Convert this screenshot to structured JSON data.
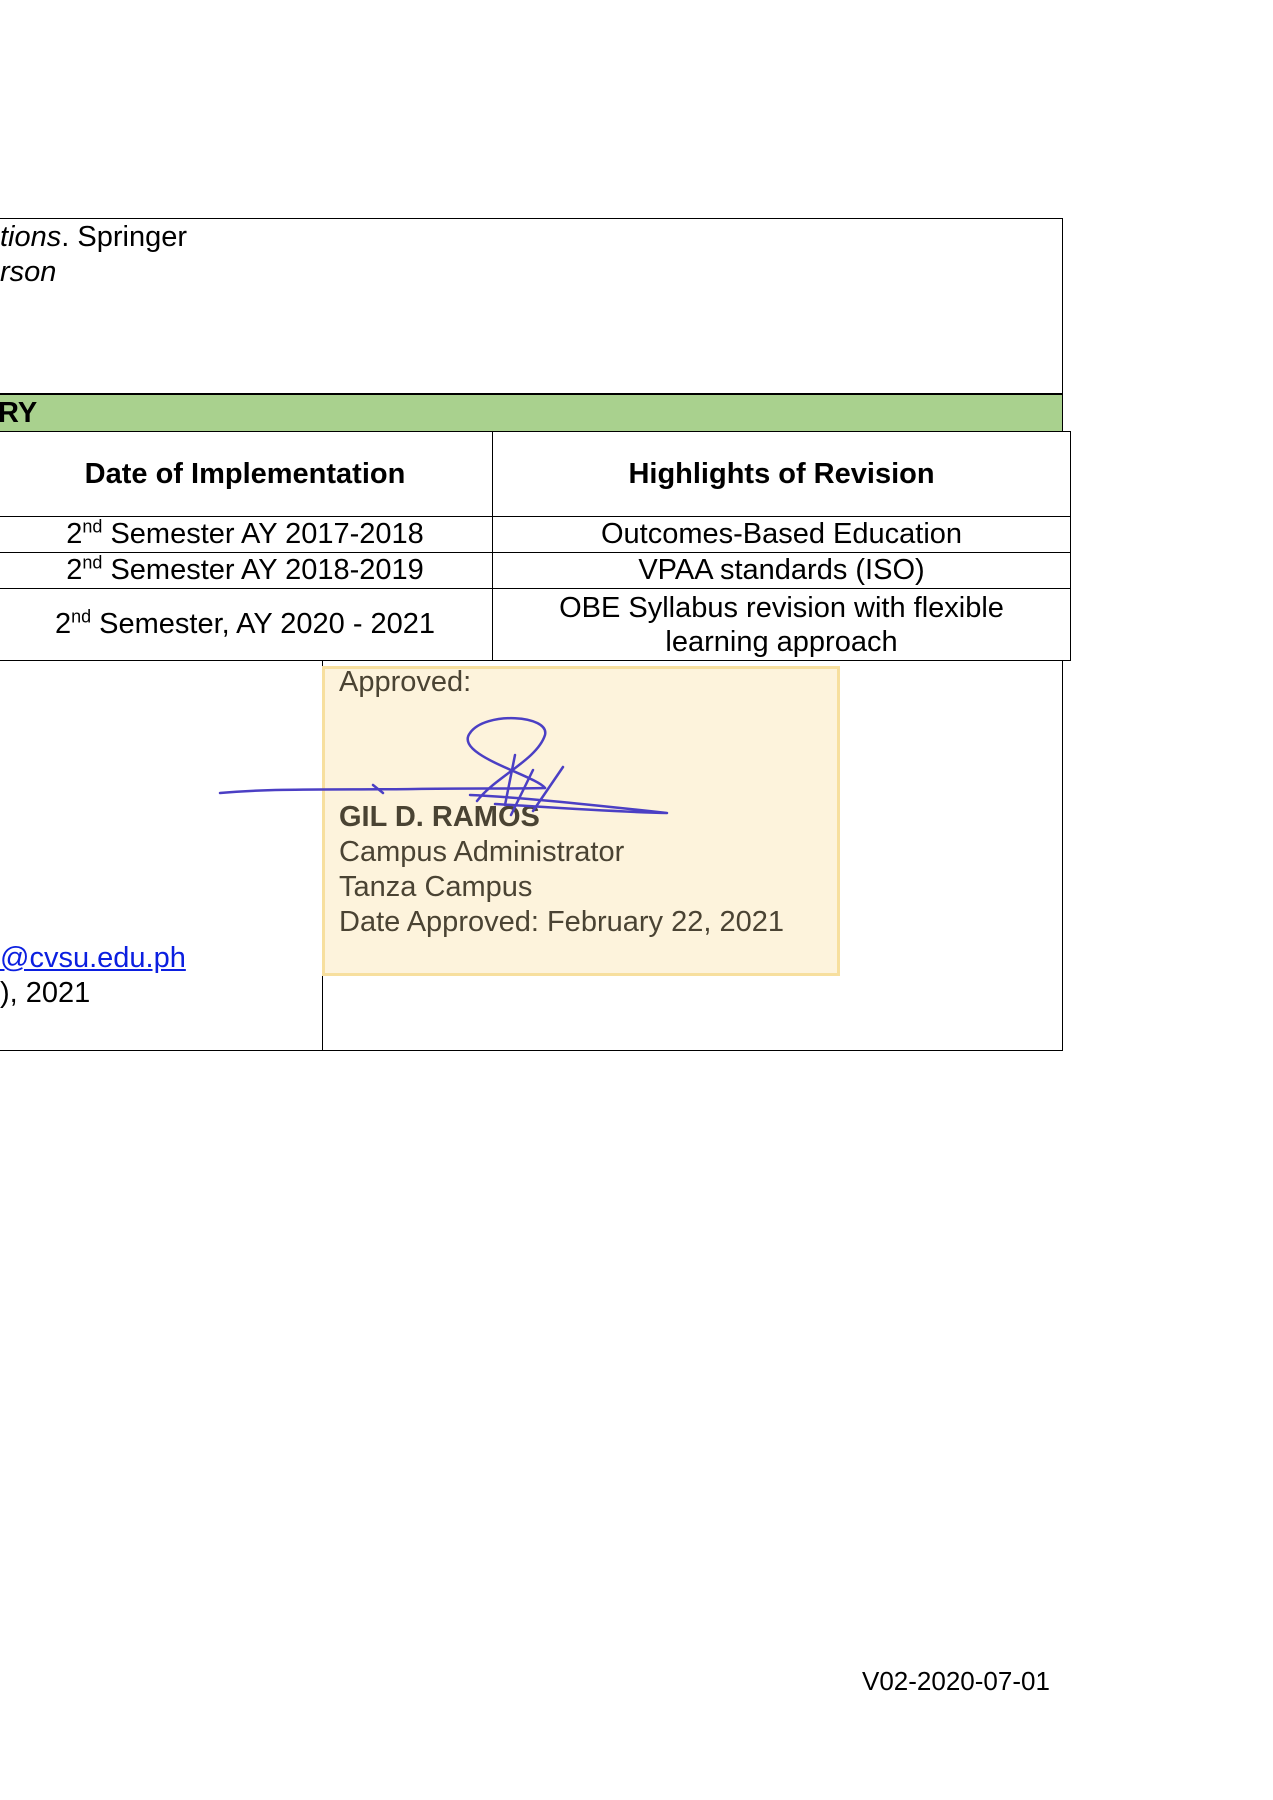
{
  "references": {
    "line1_italic": "tions",
    "line1_rest": ". Springer",
    "line2_italic": "rson"
  },
  "history_header": "RY",
  "revision_table": {
    "headers": [
      "Date of Implementation",
      "Highlights of Revision"
    ],
    "rows": [
      {
        "date_ordinal": "2",
        "date_sup": "nd",
        "date_rest": " Semester AY 2017-2018",
        "highlight": "Outcomes-Based Education"
      },
      {
        "date_ordinal": "2",
        "date_sup": "nd",
        "date_rest": " Semester AY 2018-2019",
        "highlight": "VPAA standards (ISO)"
      },
      {
        "date_ordinal": "2",
        "date_sup": "nd",
        "date_rest": " Semester, AY 2020 - 2021",
        "highlight_line1": "OBE Syllabus revision with flexible",
        "highlight_line2": "learning approach"
      }
    ]
  },
  "prepared_fragment": {
    "email": "@cvsu.edu.ph",
    "date": "), 2021"
  },
  "approval_stamp": {
    "label": "Approved:",
    "name": "GIL D. RAMOS",
    "position": "Campus Administrator",
    "campus": "Tanza Campus",
    "date_approved": "Date Approved: February 22, 2021"
  },
  "footer": {
    "version": "V02-2020-07-01"
  },
  "colors": {
    "header_green": "#a9d18e",
    "stamp_fill": "#fdf1d6",
    "stamp_border": "#f7df9e",
    "signature_ink": "#4b3fc4",
    "link_blue": "#0b1fe0"
  }
}
